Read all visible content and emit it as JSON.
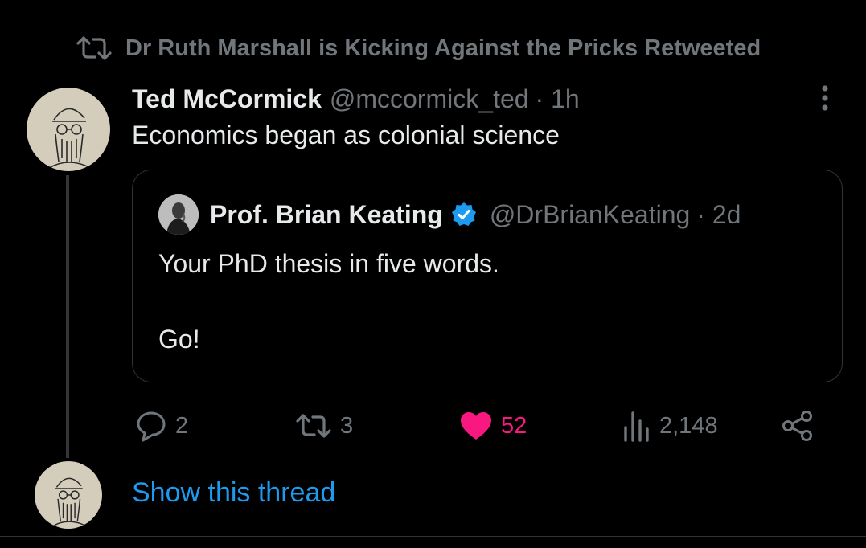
{
  "retweet_banner": {
    "text": "Dr Ruth Marshall is Kicking Against the Pricks Retweeted",
    "icon": "retweet-icon"
  },
  "tweet": {
    "author_name": "Ted McCormick",
    "author_handle": "@mccormick_ted",
    "time": "· 1h",
    "text": "Economics began as colonial science",
    "more_icon": "more-options-icon"
  },
  "quoted_tweet": {
    "author_name": "Prof. Brian Keating",
    "verified": true,
    "author_handle": "@DrBrianKeating",
    "time": "· 2d",
    "line1": "Your PhD thesis in five words.",
    "line2": "Go!"
  },
  "actions": {
    "replies": "2",
    "retweets": "3",
    "likes": "52",
    "views": "2,148"
  },
  "show_thread_label": "Show this thread",
  "colors": {
    "background": "#000000",
    "primary_text": "#e7e9ea",
    "secondary_text": "#71767b",
    "link": "#1d9bf0",
    "like": "#f91880",
    "verified": "#1d9bf0",
    "border": "#2f3336"
  }
}
